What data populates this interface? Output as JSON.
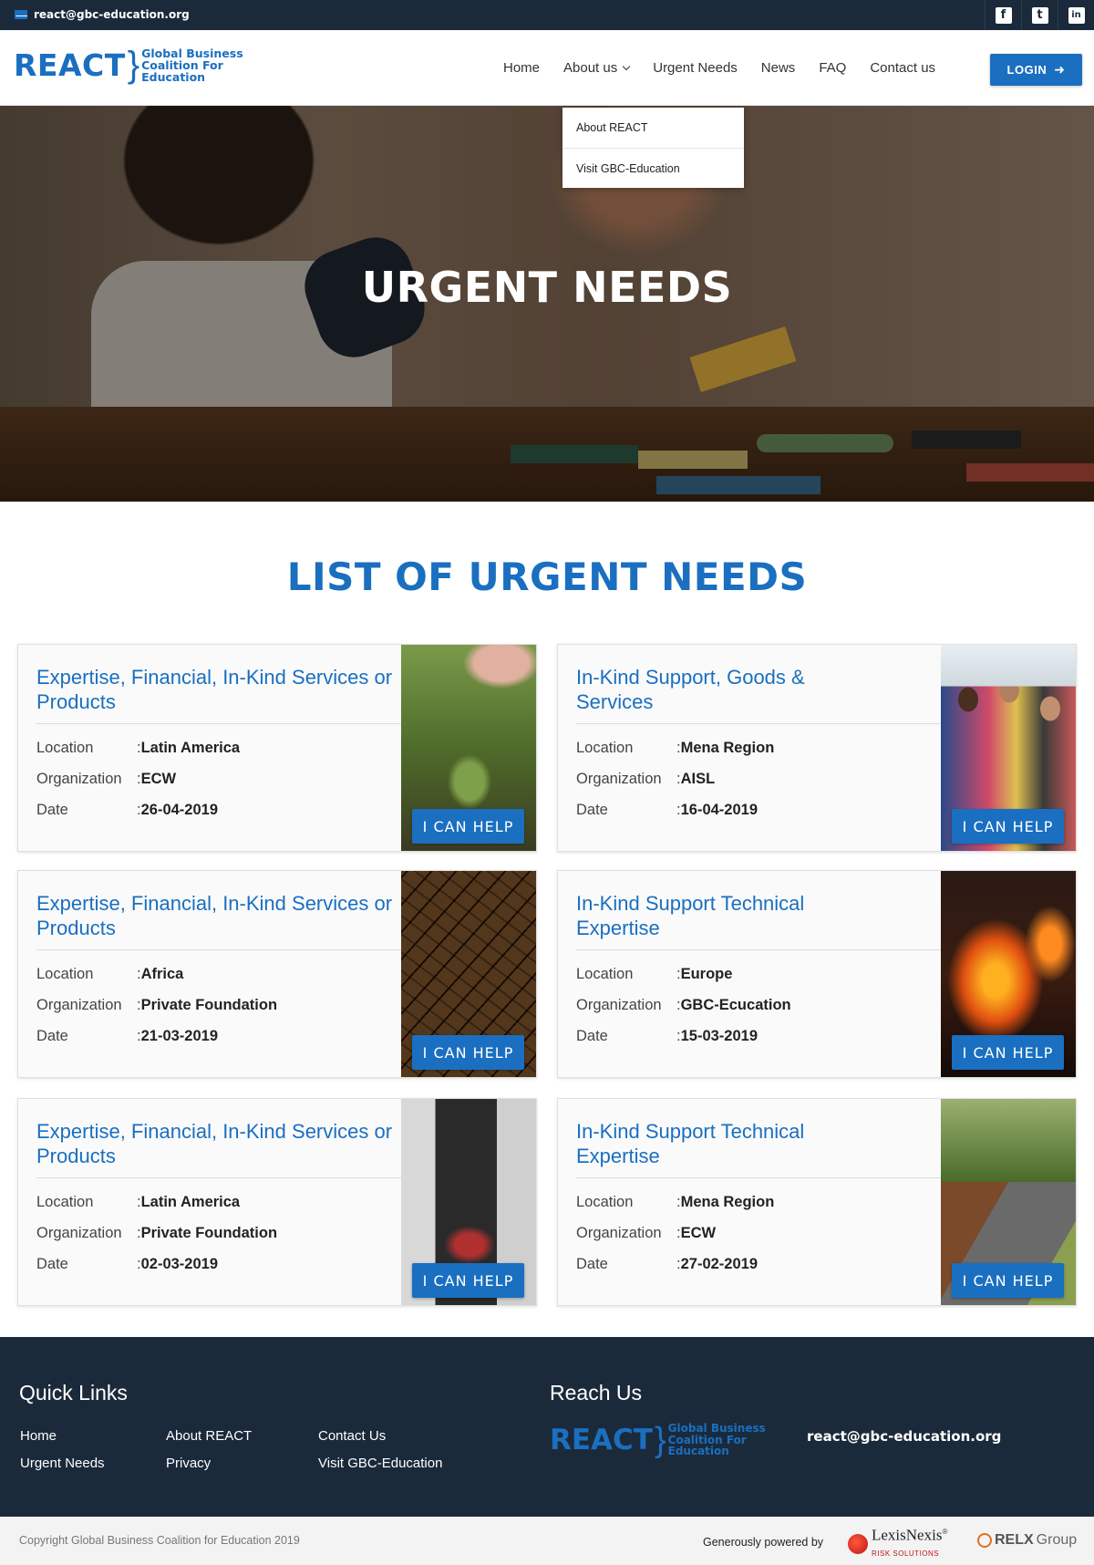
{
  "topbar": {
    "email": "react@gbc-education.org",
    "social": [
      {
        "icon": "facebook-icon",
        "glyph": "f"
      },
      {
        "icon": "twitter-icon",
        "glyph": "t"
      },
      {
        "icon": "linkedin-icon",
        "glyph": "in"
      }
    ]
  },
  "header": {
    "logo_big": "REACT",
    "logo_brace": "}",
    "logo_line1": "Global Business",
    "logo_line2": "Coalition For",
    "logo_line3": "Education",
    "nav": {
      "home": "Home",
      "about": "About us",
      "urgent": "Urgent Needs",
      "news": "News",
      "faq": "FAQ",
      "contact": "Contact us"
    },
    "login": "LOGIN",
    "login_icon": "➜"
  },
  "dropdown": {
    "item1": "About REACT",
    "item2": "Visit GBC-Education"
  },
  "hero": {
    "title": "URGENT NEEDS"
  },
  "section": {
    "title": "LIST OF URGENT NEEDS"
  },
  "labels": {
    "location": "Location",
    "organization": "Organization",
    "date": "Date",
    "help": "I CAN HELP"
  },
  "cards": [
    {
      "title": "Expertise, Financial, In-Kind Services or Products",
      "location": "Latin America",
      "organization": "ECW",
      "date": "26-04-2019"
    },
    {
      "title": "In-Kind Support, Goods & Services",
      "location": "Mena Region",
      "organization": "AISL",
      "date": "16-04-2019"
    },
    {
      "title": "Expertise, Financial, In-Kind Services or Products",
      "location": "Africa",
      "organization": "Private Foundation",
      "date": "21-03-2019"
    },
    {
      "title": "In-Kind Support Technical Expertise",
      "location": "Europe",
      "organization": "GBC-Ecucation",
      "date": "15-03-2019"
    },
    {
      "title": "Expertise, Financial, In-Kind Services or Products",
      "location": "Latin America",
      "organization": "Private Foundation",
      "date": "02-03-2019"
    },
    {
      "title": "In-Kind Support Technical Expertise",
      "location": "Mena Region",
      "organization": "ECW",
      "date": "27-02-2019"
    }
  ],
  "footer": {
    "quick_links_title": "Quick Links",
    "reach_us_title": "Reach Us",
    "links": {
      "home": "Home",
      "urgent": "Urgent Needs",
      "about": "About REACT",
      "privacy": "Privacy",
      "contact": "Contact Us",
      "visit": "Visit GBC-Education"
    },
    "email": "react@gbc-education.org",
    "logo_big": "REACT",
    "logo_brace": "}",
    "logo_line1": "Global Business",
    "logo_line2": "Coalition For",
    "logo_line3": "Education"
  },
  "bottom": {
    "copyright": "Copyright Global Business Coalition for Education 2019",
    "powered": "Generously powered by",
    "lexis": "LexisNexis",
    "lexis_mark": "®",
    "lexis_sub": "RISK SOLUTIONS",
    "relx": "RELX",
    "relx_group": "Group"
  },
  "colors": {
    "brand": "#1a6fc0",
    "dark": "#1b2a3a"
  }
}
